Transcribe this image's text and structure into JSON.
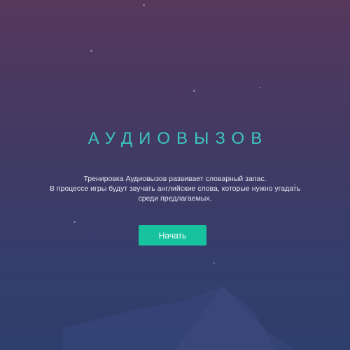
{
  "game": {
    "title": "АУДИОВЫЗОВ",
    "description_lines": [
      "Тренировка Аудиовызов развивает словарный запас.",
      "В процессе игры будут звучать английские слова, которые нужно угадать",
      "среди предлагаемых."
    ],
    "start_button_label": "Начать"
  },
  "colors": {
    "title": "#3dc6bd",
    "button": "#17c29f",
    "background_top": "#56385c",
    "background_bottom": "#2e3f6d"
  },
  "icons": {
    "moon": "crescent-moon-icon",
    "stars": "star-icon"
  }
}
